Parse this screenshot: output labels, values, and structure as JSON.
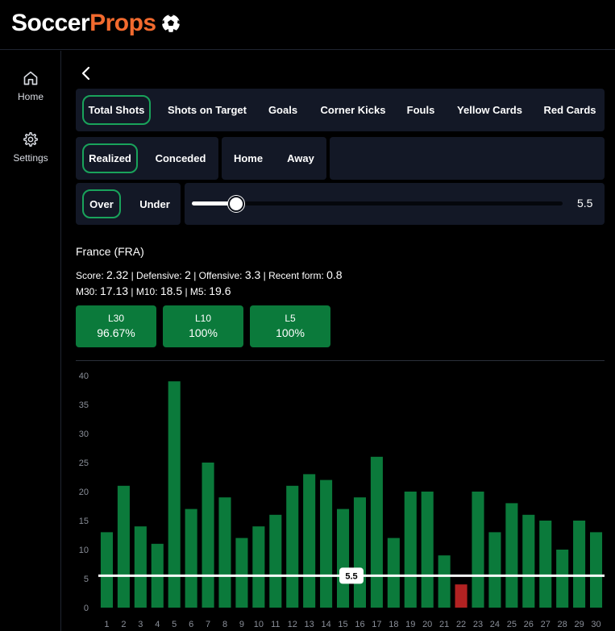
{
  "app": {
    "logo_part1": "Soccer",
    "logo_part2": "Props"
  },
  "sidebar": {
    "items": [
      {
        "label": "Home"
      },
      {
        "label": "Settings"
      }
    ]
  },
  "stat_tabs": [
    "Total Shots",
    "Shots on Target",
    "Goals",
    "Corner Kicks",
    "Fouls",
    "Yellow Cards",
    "Red Cards"
  ],
  "mode_toggle": [
    "Realized",
    "Conceded"
  ],
  "venue_toggle": [
    "Home",
    "Away"
  ],
  "line_toggle": [
    "Over",
    "Under"
  ],
  "line_value": "5.5",
  "line_fraction": 0.12,
  "team": {
    "name": "France (FRA)"
  },
  "stats_line1": {
    "score_label": "Score: ",
    "score": "2.32",
    "def_label": " | Defensive: ",
    "def": "2",
    "off_label": " | Offensive: ",
    "off": "3.3",
    "form_label": " | Recent form: ",
    "form": "0.8"
  },
  "stats_line2": {
    "m30_label": "M30: ",
    "m30": "17.13",
    "m10_label": " | M10: ",
    "m10": "18.5",
    "m5_label": " | M5: ",
    "m5": "19.6"
  },
  "cards": [
    {
      "key": "L30",
      "value": "96.67%"
    },
    {
      "key": "L10",
      "value": "100%"
    },
    {
      "key": "L5",
      "value": "100%"
    }
  ],
  "colors": {
    "accent": "#19a35b",
    "hit": "#0b7a3b",
    "miss": "#b22222",
    "brand_orange": "#f26a2e"
  },
  "chart_data": {
    "type": "bar",
    "categories": [
      "1",
      "2",
      "3",
      "4",
      "5",
      "6",
      "7",
      "8",
      "9",
      "10",
      "11",
      "12",
      "13",
      "14",
      "15",
      "16",
      "17",
      "18",
      "19",
      "20",
      "21",
      "22",
      "23",
      "24",
      "25",
      "26",
      "27",
      "28",
      "29",
      "30"
    ],
    "values": [
      13,
      21,
      14,
      11,
      39,
      17,
      25,
      19,
      12,
      14,
      16,
      21,
      23,
      22,
      17,
      19,
      26,
      12,
      20,
      20,
      9,
      4,
      20,
      13,
      18,
      16,
      15,
      10,
      15,
      13
    ],
    "ylim": [
      0,
      40
    ],
    "yticks": [
      "0",
      "5",
      "10",
      "15",
      "20",
      "25",
      "30",
      "35",
      "40"
    ],
    "threshold": 5.5,
    "threshold_label": "5.5",
    "grid": false
  }
}
